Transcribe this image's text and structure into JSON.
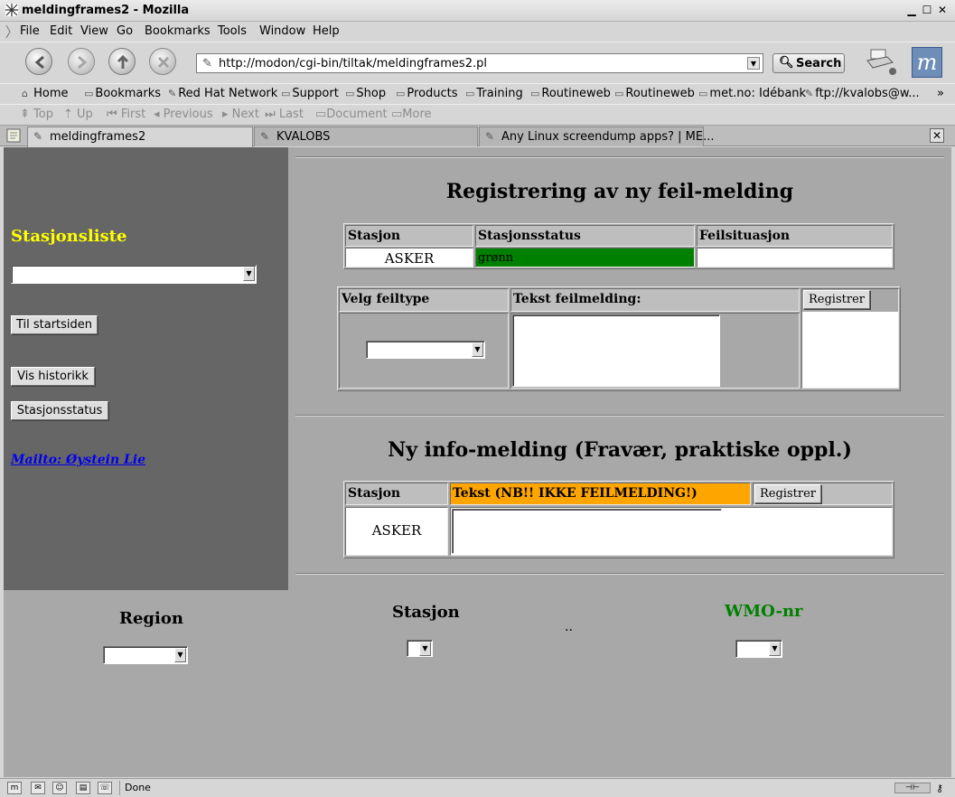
{
  "window": {
    "title": "meldingframes2 - Mozilla",
    "minimize": "▁",
    "maximize": "☐",
    "close": "✕"
  },
  "menu": [
    "File",
    "Edit",
    "View",
    "Go",
    "Bookmarks",
    "Tools",
    "Window",
    "Help"
  ],
  "nav": {
    "url": "http://modon/cgi-bin/tiltak/meldingframes2.pl",
    "search_label": "Search"
  },
  "personal_toolbar": [
    "Home",
    "Bookmarks",
    "Red Hat Network",
    "Support",
    "Shop",
    "Products",
    "Training",
    "Routineweb",
    "Routineweb",
    "met.no: Idébank",
    "ftp://kvalobs@w...",
    "»"
  ],
  "site_nav": [
    "Top",
    "Up",
    "First",
    "Previous",
    "Next",
    "Last",
    "Document",
    "More"
  ],
  "tabs": [
    "meldingframes2",
    "KVALOBS",
    "Any Linux screendump apps? | ME..."
  ],
  "left": {
    "heading": "Stasjonsliste",
    "btn_start": "Til startsiden",
    "btn_history": "Vis historikk",
    "btn_status": "Stasjonsstatus",
    "mailto": "Mailto: Øystein Lie",
    "heading_color": "#ffff00"
  },
  "error_section": {
    "heading": "Registrering av ny feil-melding",
    "col_station": "Stasjon",
    "col_status": "Stasjonsstatus",
    "col_situation": "Feilsituasjon",
    "station": "ASKER",
    "status": "grønn",
    "status_color": "#008000",
    "col_type": "Velg feiltype",
    "col_text": "Tekst feilmelding:",
    "register": "Registrer"
  },
  "info_section": {
    "heading": "Ny info-melding (Fravær, praktiske oppl.)",
    "col_station": "Stasjon",
    "col_text": "Tekst (NB!! IKKE FEILMELDING!)",
    "col_text_color": "#ffa500",
    "register": "Registrer",
    "station": "ASKER"
  },
  "bottom": {
    "region": "Region",
    "stasjon": "Stasjon",
    "dots": "..",
    "wmo": "WMO-nr",
    "wmo_color": "#008000"
  },
  "status": {
    "text": "Done"
  }
}
